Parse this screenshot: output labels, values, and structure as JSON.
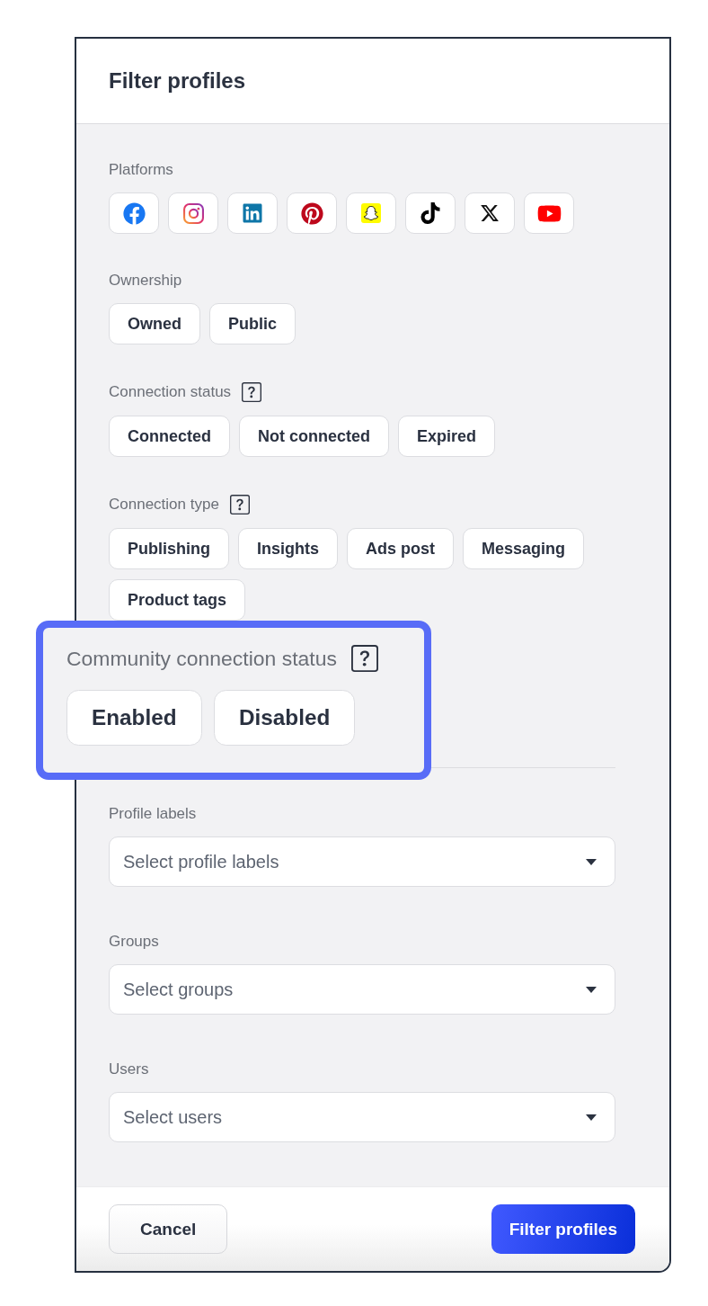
{
  "dialog": {
    "title": "Filter profiles"
  },
  "platforms": {
    "label": "Platforms",
    "items": [
      {
        "kind": "facebook",
        "selected": false
      },
      {
        "kind": "instagram",
        "selected": false
      },
      {
        "kind": "linkedin",
        "selected": false
      },
      {
        "kind": "pinterest",
        "selected": false
      },
      {
        "kind": "snapchat",
        "selected": false
      },
      {
        "kind": "tiktok",
        "selected": false
      },
      {
        "kind": "x",
        "selected": false
      },
      {
        "kind": "youtube",
        "selected": false
      }
    ]
  },
  "chip_groups": [
    {
      "label": "Ownership",
      "help": false,
      "highlighted": false,
      "options": [
        {
          "label": "Owned",
          "selected": false
        },
        {
          "label": "Public",
          "selected": false
        }
      ]
    },
    {
      "label": "Connection status",
      "help": true,
      "highlighted": false,
      "options": [
        {
          "label": "Connected",
          "selected": false
        },
        {
          "label": "Not connected",
          "selected": false
        },
        {
          "label": "Expired",
          "selected": false
        }
      ]
    },
    {
      "label": "Connection type",
      "help": true,
      "highlighted": false,
      "options": [
        {
          "label": "Publishing",
          "selected": false
        },
        {
          "label": "Insights",
          "selected": false
        },
        {
          "label": "Ads post",
          "selected": false
        },
        {
          "label": "Messaging",
          "selected": false
        },
        {
          "label": "Product tags",
          "selected": false
        }
      ]
    },
    {
      "label": "Community connection status",
      "help": true,
      "highlighted": true,
      "options": [
        {
          "label": "Enabled",
          "selected": false
        },
        {
          "label": "Disabled",
          "selected": false
        }
      ]
    }
  ],
  "selects": [
    {
      "label": "Profile labels",
      "placeholder": "Select profile labels"
    },
    {
      "label": "Groups",
      "placeholder": "Select groups"
    },
    {
      "label": "Users",
      "placeholder": "Select users"
    }
  ],
  "footer": {
    "buttons": [
      {
        "kind": "secondary",
        "label": "Cancel"
      },
      {
        "kind": "primary",
        "label": "Filter profiles"
      }
    ]
  }
}
